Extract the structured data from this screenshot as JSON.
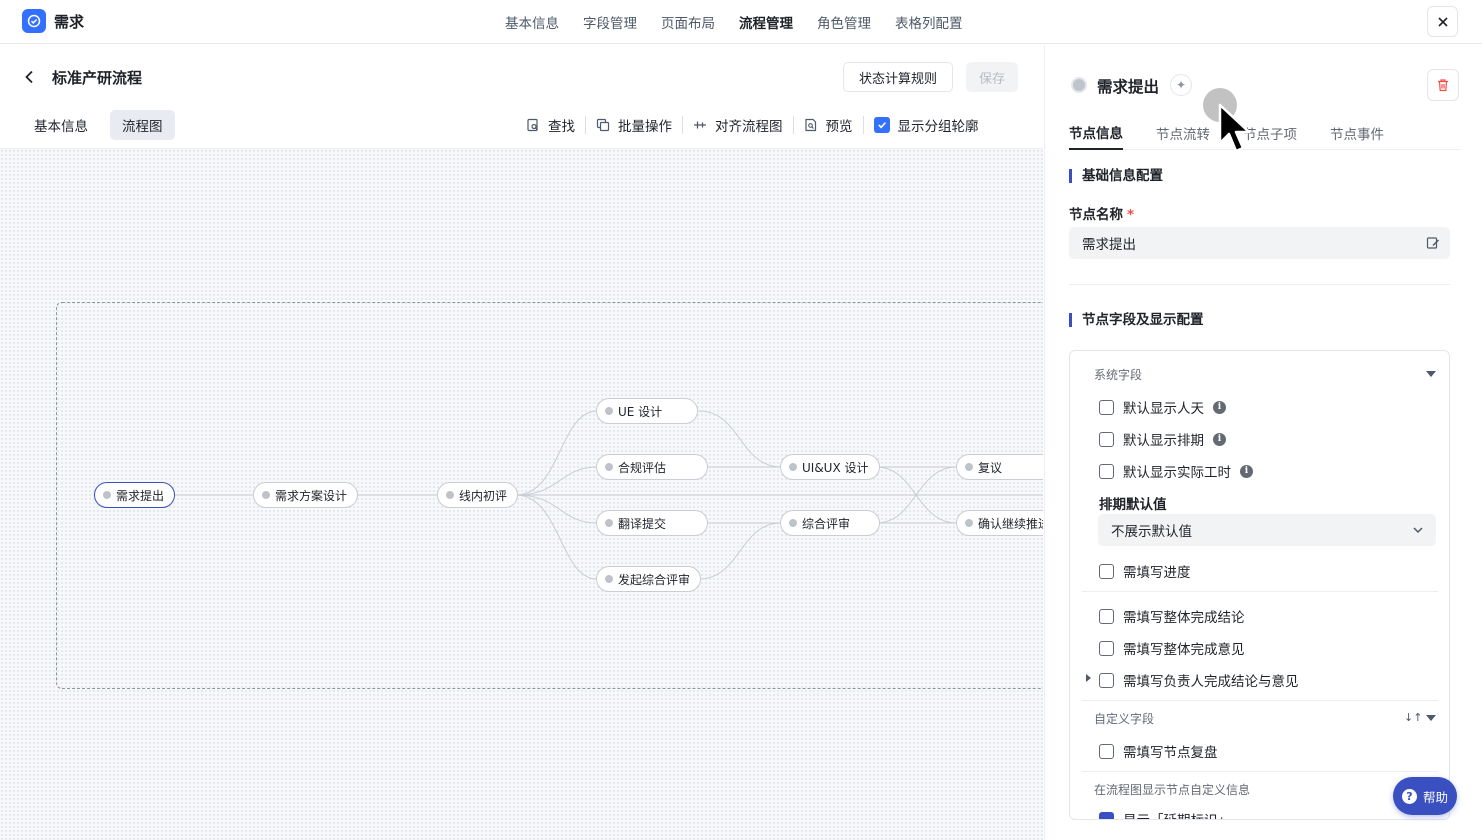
{
  "app": {
    "title": "需求"
  },
  "topnav": {
    "tabs": [
      "基本信息",
      "字段管理",
      "页面布局",
      "流程管理",
      "角色管理",
      "表格列配置"
    ],
    "active": "流程管理"
  },
  "flow": {
    "title": "标准产研流程",
    "rule_button": "状态计算规则",
    "save_button": "保存",
    "subtabs": [
      "基本信息",
      "流程图"
    ],
    "toolbar": {
      "find": "查找",
      "batch": "批量操作",
      "align": "对齐流程图",
      "preview": "预览",
      "show_group_outline": "显示分组轮廓"
    }
  },
  "nodes": {
    "n1": "需求提出",
    "n2": "需求方案设计",
    "n3": "线内初评",
    "n4": "UE 设计",
    "n5": "合规评估",
    "n6": "翻译提交",
    "n7": "发起综合评审",
    "n8": "UI&UX 设计",
    "n9": "综合评审",
    "n10": "复议",
    "n11": "确认继续推进"
  },
  "panel": {
    "node_title": "需求提出",
    "tabs": [
      "节点信息",
      "节点流转",
      "节点子项",
      "节点事件"
    ],
    "active_tab": "节点信息",
    "basic_section": "基础信息配置",
    "node_name_label": "节点名称",
    "required_mark": "*",
    "node_name_value": "需求提出",
    "fields_section": "节点字段及显示配置",
    "system_fields": "系统字段",
    "opt_show_mandays": "默认显示人天",
    "opt_show_schedule": "默认显示排期",
    "opt_show_actual_hours": "默认显示实际工时",
    "schedule_default_label": "排期默认值",
    "schedule_default_value": "不展示默认值",
    "opt_fill_progress": "需填写进度",
    "opt_fill_overall_conclusion": "需填写整体完成结论",
    "opt_fill_overall_opinion": "需填写整体完成意见",
    "opt_fill_owner_conclusion": "需填写负责人完成结论与意见",
    "custom_fields": "自定义字段",
    "opt_fill_review": "需填写节点复盘",
    "custom_info_section": "在流程图显示节点自定义信息",
    "opt_show_schedule_tag": "显示「延期标识」"
  },
  "help": {
    "label": "帮助"
  },
  "colors": {
    "accent": "#3a4fc0",
    "brand": "#3370ff",
    "danger": "#f54a45"
  }
}
